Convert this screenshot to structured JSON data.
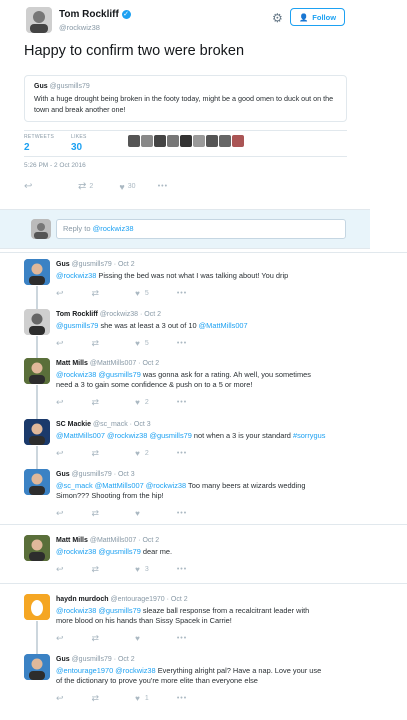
{
  "header": {
    "name": "Tom Rockliff",
    "handle": "@rockwiz38",
    "follow_label": "Follow"
  },
  "main_tweet": {
    "text": "Happy to confirm two were broken",
    "quote": {
      "name": "Gus",
      "handle": "@gusmills79",
      "text": "With a huge drought being broken in the footy today, might be a good omen to duck out on the town and break another one!"
    },
    "stats": {
      "retweets_label": "RETWEETS",
      "retweets": "2",
      "likes_label": "LIKES",
      "likes": "30"
    },
    "timestamp": "5:26 PM - 2 Oct 2016",
    "actions": {
      "retweets": "2",
      "likes": "30"
    }
  },
  "reply_box": {
    "placeholder_prefix": "Reply to ",
    "placeholder_handle": "@rockwiz38"
  },
  "replies": [
    {
      "name": "Gus",
      "handle": "@gusmills79",
      "date": "Oct 2",
      "line1": [
        {
          "t": "@rockwiz38",
          "m": true
        },
        {
          "t": " Pissing the bed was not what I was talking about! You drip",
          "m": false
        }
      ],
      "line2": [],
      "retweets": "",
      "likes": "5"
    },
    {
      "name": "Tom Rockliff",
      "handle": "@rockwiz38",
      "date": "Oct 2",
      "line1": [
        {
          "t": "@gusmills79",
          "m": true
        },
        {
          "t": " she was at least a 3 out of 10 ",
          "m": false
        },
        {
          "t": "@MattMills007",
          "m": true
        }
      ],
      "line2": [],
      "retweets": "",
      "likes": "5"
    },
    {
      "name": "Matt Mills",
      "handle": "@MattMills007",
      "date": "Oct 2",
      "line1": [
        {
          "t": "@rockwiz38 @gusmills79",
          "m": true
        },
        {
          "t": " was gonna ask for a rating. Ah well, you sometimes",
          "m": false
        }
      ],
      "line2": [
        {
          "t": "need a 3 to gain some confidence & push on to a 5 or more!",
          "m": false
        }
      ],
      "retweets": "",
      "likes": "2"
    },
    {
      "name": "SC Mackie",
      "handle": "@sc_mack",
      "date": "Oct 3",
      "line1": [
        {
          "t": "@MattMills007 @rockwiz38 @gusmills79",
          "m": true
        },
        {
          "t": " not when a 3 is your standard ",
          "m": false
        },
        {
          "t": "#sorrygus",
          "m": true
        }
      ],
      "line2": [],
      "retweets": "",
      "likes": "2"
    },
    {
      "name": "Gus",
      "handle": "@gusmills79",
      "date": "Oct 3",
      "line1": [
        {
          "t": "@sc_mack @MattMills007 @rockwiz38",
          "m": true
        },
        {
          "t": " Too many beers at wizards wedding",
          "m": false
        }
      ],
      "line2": [
        {
          "t": "Simon??? Shooting from the hip!",
          "m": false
        }
      ],
      "retweets": "",
      "likes": ""
    },
    {
      "name": "Matt Mills",
      "handle": "@MattMills007",
      "date": "Oct 2",
      "line1": [
        {
          "t": "@rockwiz38 @gusmills79",
          "m": true
        },
        {
          "t": " dear me.",
          "m": false
        }
      ],
      "line2": [],
      "retweets": "",
      "likes": "3"
    },
    {
      "name": "haydn murdoch",
      "handle": "@entourage1970",
      "date": "Oct 2",
      "line1": [
        {
          "t": "@rockwiz38 @gusmills79",
          "m": true
        },
        {
          "t": " sleaze ball response from a recalcitrant leader with",
          "m": false
        }
      ],
      "line2": [
        {
          "t": "more blood on his hands than Sissy Spacek in Carrie!",
          "m": false
        }
      ],
      "retweets": "",
      "likes": ""
    },
    {
      "name": "Gus",
      "handle": "@gusmills79",
      "date": "Oct 2",
      "line1": [
        {
          "t": "@entourage1970 @rockwiz38",
          "m": true
        },
        {
          "t": " Everything alright pal? Have a nap. Love your use",
          "m": false
        }
      ],
      "line2": [
        {
          "t": "of the dictionary to prove you're more elite than everyone else",
          "m": false
        }
      ],
      "retweets": "",
      "likes": "1"
    }
  ],
  "colors": {
    "accent": "#1da1f2",
    "muted": "#8899a6",
    "border": "#e1e8ed",
    "reply_bg": "#f5f8fa"
  },
  "icons": [
    "gear-icon",
    "follow-icon",
    "verified-icon",
    "reply-icon",
    "retweet-icon",
    "like-icon",
    "more-icon",
    "egg-avatar-icon"
  ]
}
